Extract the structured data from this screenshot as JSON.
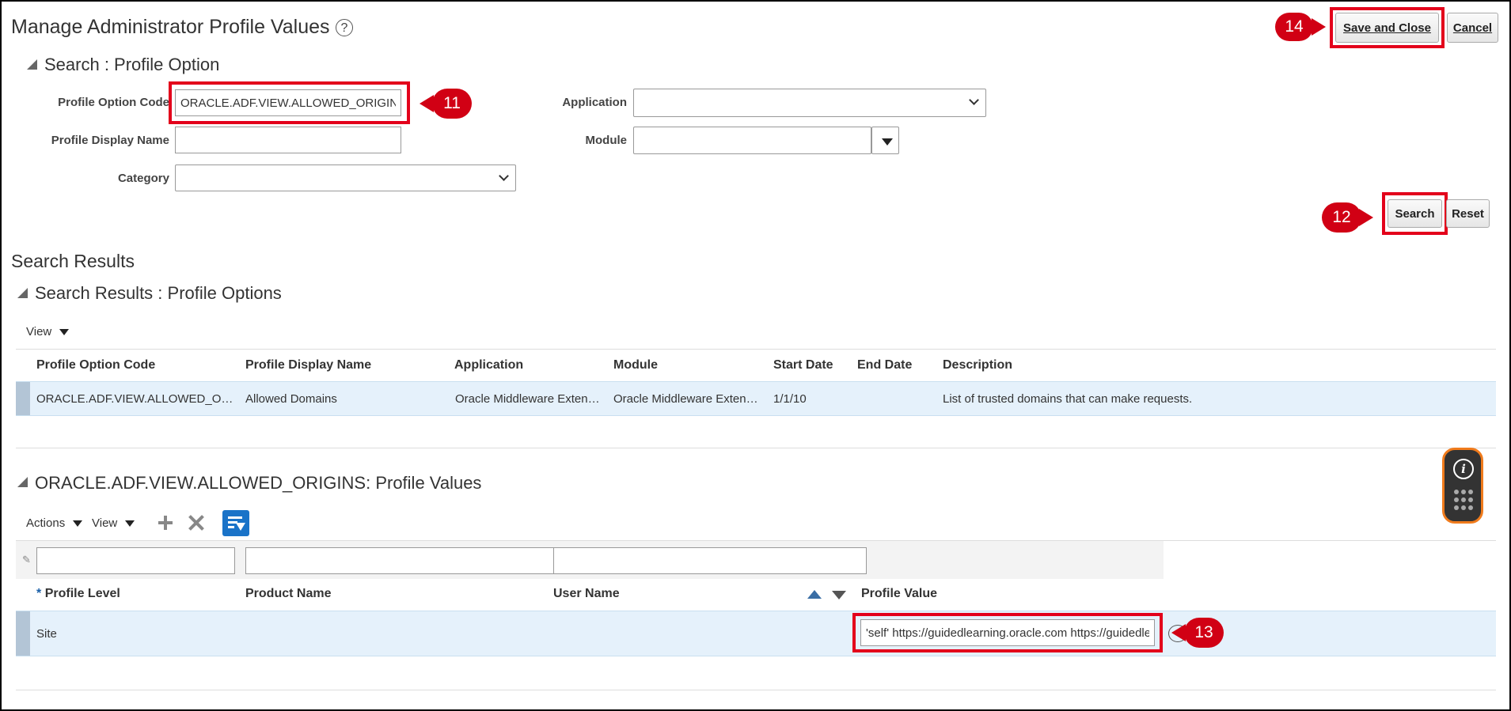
{
  "header": {
    "title": "Manage Administrator Profile Values",
    "help_symbol": "?",
    "save_close_label": "Save and Close",
    "cancel_label": "Cancel"
  },
  "search": {
    "section_title": "Search : Profile Option",
    "profile_option_code_label": "Profile Option Code",
    "profile_option_code_value": "ORACLE.ADF.VIEW.ALLOWED_ORIGINS",
    "profile_display_name_label": "Profile Display Name",
    "profile_display_name_value": "",
    "category_label": "Category",
    "application_label": "Application",
    "module_label": "Module",
    "search_label": "Search",
    "reset_label": "Reset"
  },
  "results": {
    "heading": "Search Results",
    "section_title": "Search Results : Profile Options",
    "view_label": "View",
    "columns": [
      "Profile Option Code",
      "Profile Display Name",
      "Application",
      "Module",
      "Start Date",
      "End Date",
      "Description"
    ],
    "rows": [
      [
        "ORACLE.ADF.VIEW.ALLOWED_ORIGINS",
        "Allowed Domains",
        "Oracle Middleware Extensions for Applications",
        "Oracle Middleware Extensions for Applications",
        "1/1/10",
        "",
        "List of trusted domains that can make requests."
      ]
    ]
  },
  "values": {
    "section_title": "ORACLE.ADF.VIEW.ALLOWED_ORIGINS: Profile Values",
    "actions_label": "Actions",
    "view_label": "View",
    "required_mark": "*",
    "columns": [
      "Profile Level",
      "Product Name",
      "User Name",
      "Profile Value"
    ],
    "rows": [
      [
        "Site",
        "",
        "",
        "'self' https://guidedlearning.oracle.com https://guidedlearning.oracle.com"
      ]
    ]
  },
  "callouts": {
    "c11": "11",
    "c12": "12",
    "c13": "13",
    "c14": "14"
  },
  "colors": {
    "callout_red": "#d10014",
    "highlight_row": "#e5f1fb",
    "accent_blue": "#1a73c8"
  }
}
